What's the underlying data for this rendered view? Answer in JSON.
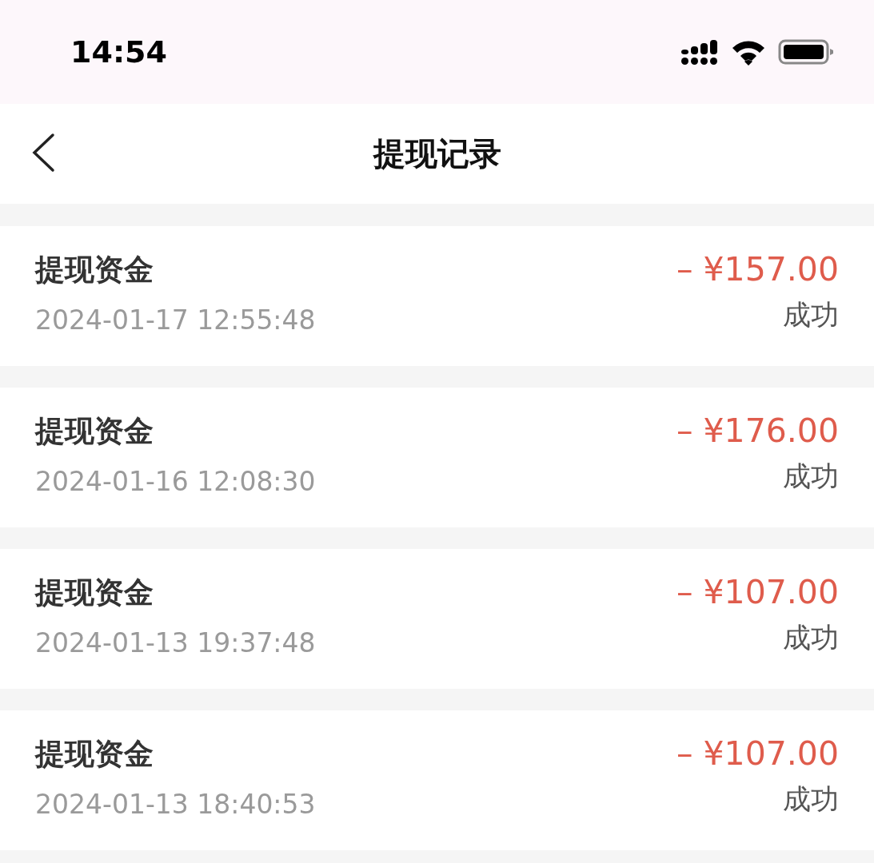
{
  "status_bar": {
    "time": "14:54"
  },
  "nav": {
    "title": "提现记录"
  },
  "records": [
    {
      "title": "提现资金",
      "date": "2024-01-17 12:55:48",
      "amount": "– ¥157.00",
      "status": "成功"
    },
    {
      "title": "提现资金",
      "date": "2024-01-16 12:08:30",
      "amount": "– ¥176.00",
      "status": "成功"
    },
    {
      "title": "提现资金",
      "date": "2024-01-13 19:37:48",
      "amount": "– ¥107.00",
      "status": "成功"
    },
    {
      "title": "提现资金",
      "date": "2024-01-13 18:40:53",
      "amount": "– ¥107.00",
      "status": "成功"
    }
  ]
}
